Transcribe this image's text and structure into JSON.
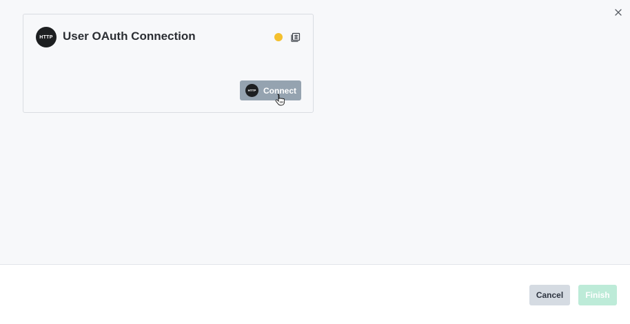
{
  "card": {
    "logo_text": "HTTP",
    "title": "User OAuth Connection",
    "status_color": "#f4c02e",
    "connect": {
      "logo_text": "HTTP",
      "label": "Connect"
    }
  },
  "footer": {
    "cancel_label": "Cancel",
    "finish_label": "Finish"
  },
  "icons": {
    "close": "close-icon",
    "details": "table-icon",
    "cursor": "hand-cursor-icon"
  }
}
